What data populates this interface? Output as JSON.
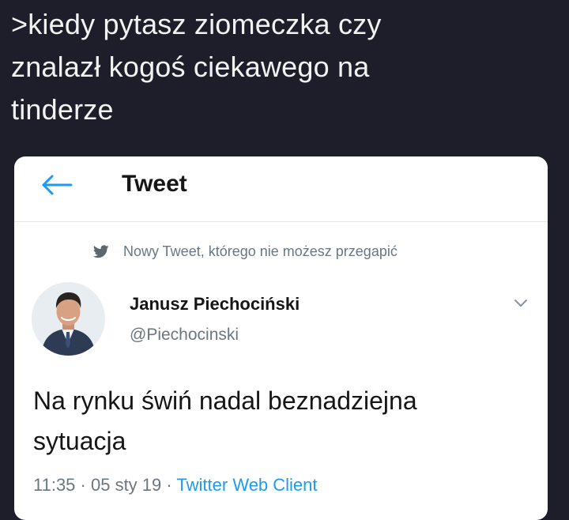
{
  "caption": {
    "text": ">kiedy pytasz ziomeczka czy\nznalazł kogoś ciekawego na\ntinderze"
  },
  "tweet_card": {
    "header": {
      "back_icon": "arrow-left-icon",
      "title": "Tweet"
    },
    "context": {
      "icon": "bird-icon",
      "text": "Nowy Tweet, którego nie możesz przegapić"
    },
    "author": {
      "name": "Janusz Piechociński",
      "handle": "@Piechocinski",
      "menu_icon": "chevron-down-icon"
    },
    "text": "Na rynku świń nadal beznadziejna\nsytuacja",
    "meta": {
      "time": "11:35",
      "separator": " · ",
      "date": "05 sty 19",
      "source": "Twitter Web Client"
    }
  },
  "colors": {
    "background": "#1e1e2b",
    "accent": "#1d9bf0",
    "secondary_text": "#6a7680"
  }
}
